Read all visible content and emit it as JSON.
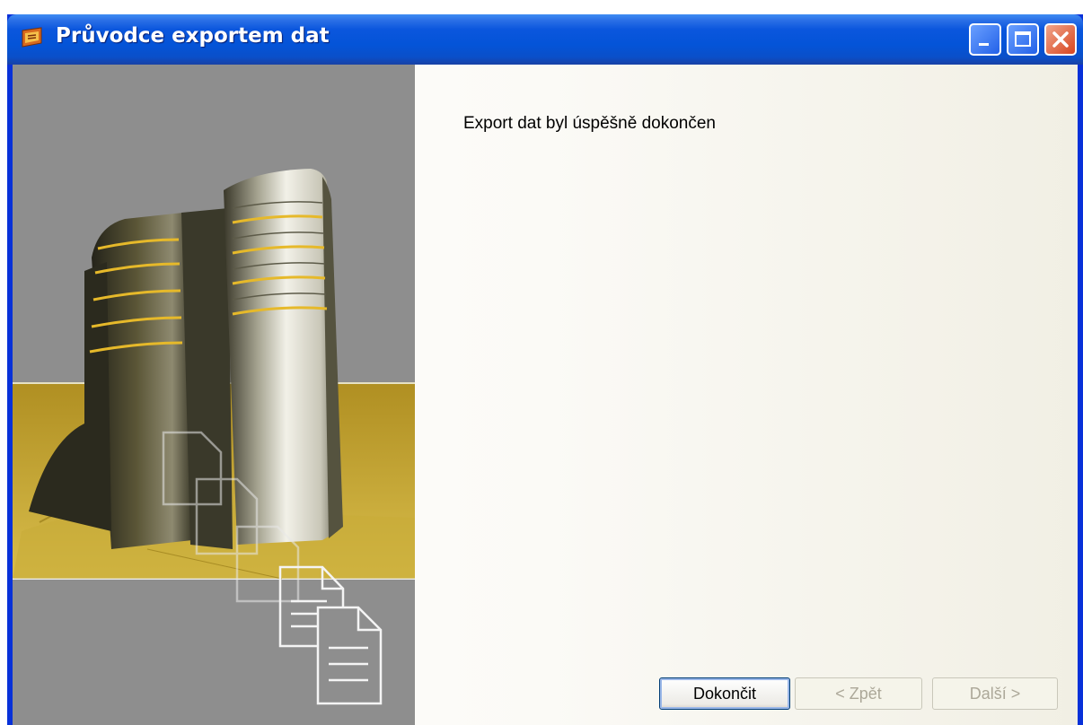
{
  "window": {
    "title": "Průvodce exportem dat",
    "icon": "app-wizard-icon"
  },
  "titlebar_buttons": {
    "minimize_icon": "minimize-icon",
    "maximize_icon": "maximize-icon",
    "close_icon": "close-icon"
  },
  "content": {
    "message": "Export dat byl úspěšně dokončen"
  },
  "buttons": {
    "finish": "Dokončit",
    "back": "< Zpět",
    "next": "Další >"
  },
  "colors": {
    "titlebar": "#0454d8",
    "close_button": "#d7451f",
    "art_background": "#8d8d8d",
    "art_gold": "#c7a531"
  }
}
